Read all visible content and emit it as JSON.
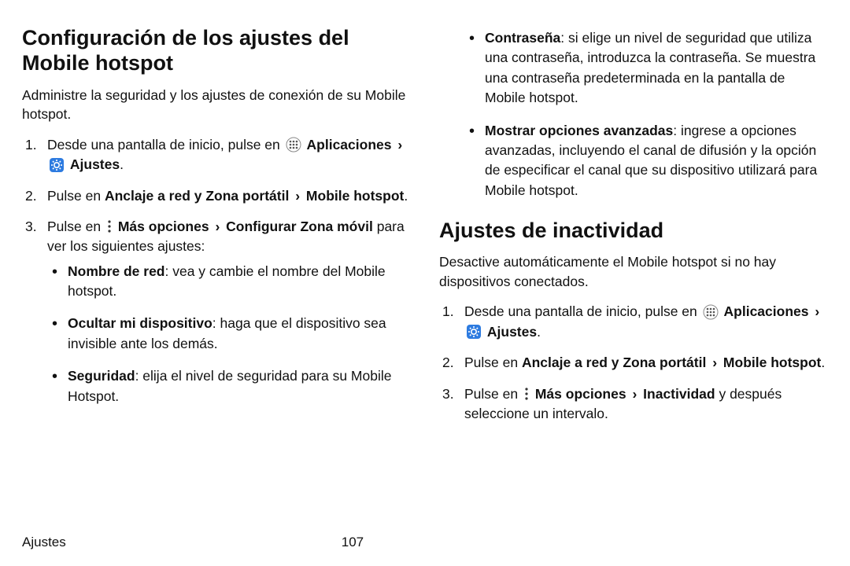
{
  "left": {
    "title": "Configuración de los ajustes del Mobile hotspot",
    "intro": "Administre la seguridad y los ajustes de conexión de su Mobile hotspot.",
    "step1_a": "Desde una pantalla de inicio, pulse en ",
    "step1_apps": "Aplicaciones",
    "step1_settings": "Ajustes",
    "step1_end": ".",
    "step2_a": "Pulse en ",
    "step2_b": "Anclaje a red y Zona portátil",
    "step2_c": "Mobile hotspot",
    "step2_end": ".",
    "step3_a": "Pulse en ",
    "step3_more": "Más opciones",
    "step3_conf": "Configurar Zona móvil",
    "step3_b": " para ver los siguientes ajustes:",
    "bullets": {
      "b1_label": "Nombre de red",
      "b1_text": ": vea y cambie el nombre del Mobile hotspot.",
      "b2_label": "Ocultar mi dispositivo",
      "b2_text": ": haga que el dispositivo sea invisible ante los demás.",
      "b3_label": "Seguridad",
      "b3_text": ": elija el nivel de seguridad para su Mobile Hotspot."
    }
  },
  "right": {
    "bullets_top": {
      "b1_label": "Contraseña",
      "b1_text": ": si elige un nivel de seguridad que utiliza una contraseña, introduzca la contraseña. Se muestra una contraseña predeterminada en la pantalla de Mobile hotspot.",
      "b2_label": "Mostrar opciones avanzadas",
      "b2_text": ": ingrese a opciones avanzadas, incluyendo el canal de difusión y la opción de especificar el canal que su dispositivo utilizará para Mobile hotspot."
    },
    "title2": "Ajustes de inactividad",
    "intro2": "Desactive automáticamente el Mobile hotspot si no hay dispositivos conectados.",
    "step1_a": "Desde una pantalla de inicio, pulse en ",
    "step1_apps": "Aplicaciones",
    "step1_settings": "Ajustes",
    "step1_end": ".",
    "step2_a": "Pulse en ",
    "step2_b": "Anclaje a red y Zona portátil",
    "step2_c": "Mobile hotspot",
    "step2_end": ".",
    "step3_a": "Pulse en ",
    "step3_more": "Más opciones",
    "step3_inact": "Inactividad",
    "step3_b": " y después seleccione un intervalo."
  },
  "footer": {
    "section": "Ajustes",
    "page": "107"
  },
  "chev": "›"
}
